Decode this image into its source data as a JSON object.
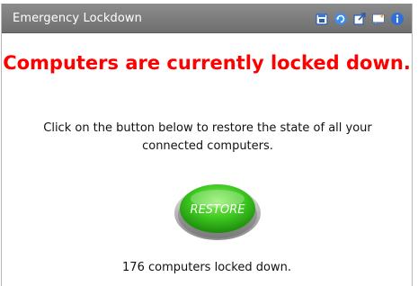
{
  "panel": {
    "title": "Emergency Lockdown",
    "toolbar_icons": [
      "export-icon",
      "refresh-icon",
      "popout-icon",
      "comment-icon",
      "info-icon"
    ]
  },
  "main": {
    "headline": "Computers are currently locked down.",
    "description": "Click on the button below to restore the state of all your connected computers.",
    "restore_button_label": "RESTORE",
    "status_text": "176 computers locked down."
  },
  "colors": {
    "headline": "#ff0000",
    "titlebar": "#7d7d7d",
    "button_green": "#35c21c"
  }
}
